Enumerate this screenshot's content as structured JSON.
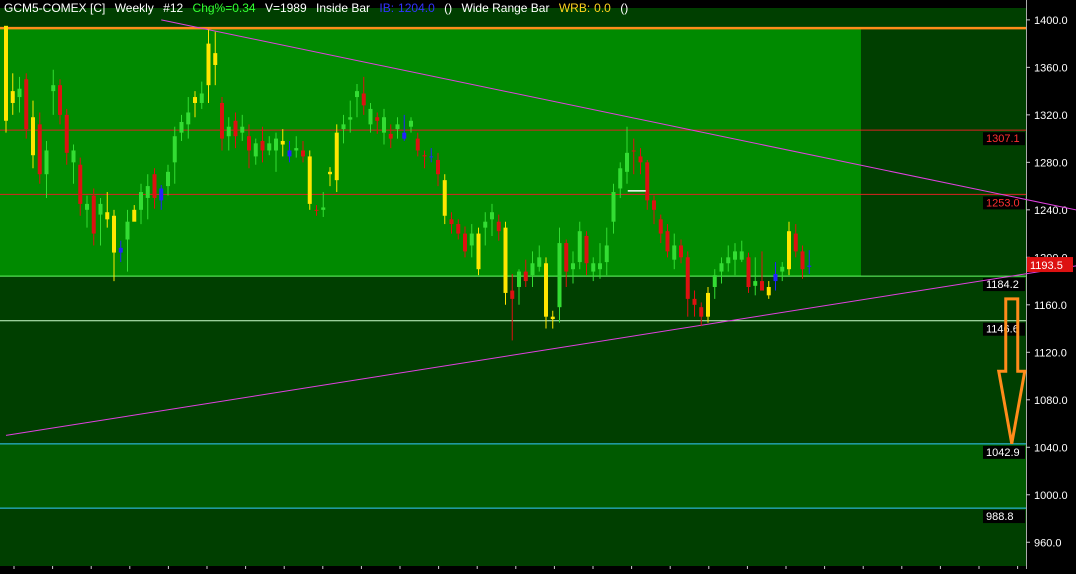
{
  "header": {
    "symbol": "GCM5-COMEX [C]",
    "timeframe": "Weekly",
    "bar_number": "#12",
    "chg_label": "Chg%=",
    "chg_value": "0.34",
    "volume": "V=1989",
    "inside_bar": "Inside Bar",
    "ib_label": "IB:",
    "ib_value": "1204.0",
    "ib_paren": "()",
    "wide_range_bar": "Wide Range Bar",
    "wrb_label": "WRB:",
    "wrb_value": "0.0",
    "wrb_paren": "()"
  },
  "colors": {
    "background": "#000000",
    "panel_bright": "#008a00",
    "panel_dark": "#003f00",
    "panel_mid": "#005a00",
    "up_candle": "#33dd33",
    "down_candle": "#dd1111",
    "inside_bar": "#ffe600",
    "trendline": "#e040e0",
    "resistance": "#dd2222",
    "support": "#66ff66",
    "target": "#33ccff",
    "arrow": "#ff8c1a"
  },
  "chart_data": {
    "type": "candlestick",
    "ylim": [
      940,
      1410
    ],
    "y_ticks": [
      "1400.0",
      "1360.0",
      "1320.0",
      "1280.0",
      "1240.0",
      "1200.0",
      "1160.0",
      "1120.0",
      "1080.0",
      "1040.0",
      "1000.0",
      "960.0"
    ],
    "y_tick_values": [
      1400,
      1360,
      1320,
      1280,
      1240,
      1200,
      1160,
      1120,
      1080,
      1040,
      1000,
      960
    ],
    "last_price": 1193.5,
    "last_price_label": "1193.5",
    "levels": [
      {
        "value": 1393.0,
        "label": "",
        "color": "#ff8c1a"
      },
      {
        "value": 1307.1,
        "label": "1307.1",
        "color": "#dd2222"
      },
      {
        "value": 1253.0,
        "label": "1253.0",
        "color": "#dd2222"
      },
      {
        "value": 1184.2,
        "label": "1184.2",
        "color": "#66ff66"
      },
      {
        "value": 1146.6,
        "label": "1146.6",
        "color": "#ccffcc"
      },
      {
        "value": 1042.9,
        "label": "1042.9",
        "color": "#33ccff"
      },
      {
        "value": 988.8,
        "label": "988.8",
        "color": "#33ccff"
      }
    ],
    "trendlines": [
      {
        "x": [
          23,
          161
        ],
        "y": [
          1400.0,
          1237.0
        ]
      },
      {
        "x": [
          0,
          161
        ],
        "y": [
          1050.0,
          1195.0
        ]
      }
    ],
    "target_arrow": {
      "x": 149,
      "y_from": 1165,
      "y_to": 1043
    },
    "candles": [
      [
        0,
        1395,
        1390,
        1305,
        1315,
        "y"
      ],
      [
        1,
        1340,
        1355,
        1320,
        1330,
        "y"
      ],
      [
        2,
        1342,
        1352,
        1322,
        1335,
        "g"
      ],
      [
        3,
        1350,
        1355,
        1300,
        1308,
        "r"
      ],
      [
        4,
        1318,
        1332,
        1275,
        1286,
        "y"
      ],
      [
        5,
        1312,
        1322,
        1262,
        1270,
        "r"
      ],
      [
        6,
        1290,
        1298,
        1250,
        1270,
        "g"
      ],
      [
        7,
        1340,
        1358,
        1320,
        1345,
        "g"
      ],
      [
        8,
        1345,
        1350,
        1312,
        1320,
        "r"
      ],
      [
        9,
        1320,
        1325,
        1278,
        1288,
        "r"
      ],
      [
        10,
        1290,
        1295,
        1262,
        1280,
        "g"
      ],
      [
        11,
        1278,
        1284,
        1235,
        1245,
        "r"
      ],
      [
        12,
        1240,
        1252,
        1225,
        1245,
        "g"
      ],
      [
        13,
        1252,
        1258,
        1210,
        1220,
        "r"
      ],
      [
        14,
        1245,
        1250,
        1210,
        1236,
        "g"
      ],
      [
        15,
        1238,
        1255,
        1225,
        1232,
        "y"
      ],
      [
        16,
        1235,
        1240,
        1180,
        1204,
        "y"
      ],
      [
        17,
        1208,
        1214,
        1196,
        1204,
        "b"
      ],
      [
        18,
        1215,
        1240,
        1188,
        1230,
        "g"
      ],
      [
        19,
        1230,
        1244,
        1232,
        1240,
        "y"
      ],
      [
        20,
        1240,
        1262,
        1228,
        1255,
        "g"
      ],
      [
        21,
        1250,
        1270,
        1232,
        1260,
        "g"
      ],
      [
        22,
        1270,
        1275,
        1241,
        1250,
        "r"
      ],
      [
        23,
        1248,
        1261,
        1240,
        1258,
        "b"
      ],
      [
        24,
        1260,
        1278,
        1252,
        1272,
        "g"
      ],
      [
        25,
        1280,
        1310,
        1262,
        1302,
        "g"
      ],
      [
        26,
        1305,
        1320,
        1298,
        1314,
        "g"
      ],
      [
        27,
        1312,
        1335,
        1300,
        1322,
        "g"
      ],
      [
        28,
        1330,
        1340,
        1318,
        1335,
        "y"
      ],
      [
        29,
        1338,
        1348,
        1325,
        1330,
        "g"
      ],
      [
        30,
        1345,
        1392,
        1330,
        1380,
        "y"
      ],
      [
        31,
        1372,
        1390,
        1345,
        1362,
        "y"
      ],
      [
        32,
        1330,
        1335,
        1290,
        1300,
        "r"
      ],
      [
        33,
        1302,
        1318,
        1290,
        1310,
        "g"
      ],
      [
        34,
        1315,
        1322,
        1292,
        1302,
        "r"
      ],
      [
        35,
        1305,
        1320,
        1298,
        1310,
        "g"
      ],
      [
        36,
        1302,
        1312,
        1275,
        1290,
        "r"
      ],
      [
        37,
        1285,
        1300,
        1278,
        1296,
        "g"
      ],
      [
        38,
        1298,
        1310,
        1280,
        1290,
        "r"
      ],
      [
        39,
        1290,
        1302,
        1286,
        1296,
        "g"
      ],
      [
        40,
        1290,
        1305,
        1272,
        1300,
        "g"
      ],
      [
        41,
        1298,
        1308,
        1285,
        1295,
        "y"
      ],
      [
        42,
        1290,
        1298,
        1280,
        1285,
        "b"
      ],
      [
        43,
        1292,
        1302,
        1284,
        1290,
        "g"
      ],
      [
        44,
        1290,
        1298,
        1280,
        1285,
        "r"
      ],
      [
        45,
        1285,
        1290,
        1240,
        1245,
        "y"
      ],
      [
        46,
        1240,
        1244,
        1235,
        1240,
        "r"
      ],
      [
        47,
        1240,
        1255,
        1234,
        1242,
        "g"
      ],
      [
        48,
        1270,
        1276,
        1260,
        1272,
        "y"
      ],
      [
        49,
        1265,
        1312,
        1255,
        1305,
        "y"
      ],
      [
        50,
        1308,
        1320,
        1296,
        1312,
        "g"
      ],
      [
        51,
        1316,
        1332,
        1305,
        1318,
        "g"
      ],
      [
        52,
        1335,
        1346,
        1318,
        1340,
        "g"
      ],
      [
        53,
        1338,
        1352,
        1320,
        1328,
        "r"
      ],
      [
        54,
        1325,
        1330,
        1305,
        1312,
        "g"
      ],
      [
        55,
        1315,
        1322,
        1304,
        1318,
        "r"
      ],
      [
        56,
        1318,
        1325,
        1295,
        1305,
        "g"
      ],
      [
        57,
        1304,
        1312,
        1292,
        1300,
        "r"
      ],
      [
        58,
        1308,
        1318,
        1300,
        1312,
        "g"
      ],
      [
        59,
        1305,
        1320,
        1298,
        1300,
        "b"
      ],
      [
        60,
        1310,
        1318,
        1305,
        1315,
        "g"
      ],
      [
        61,
        1300,
        1305,
        1285,
        1290,
        "r"
      ],
      [
        62,
        1286,
        1290,
        1275,
        1285,
        "r"
      ],
      [
        63,
        1285,
        1292,
        1280,
        1285,
        "b"
      ],
      [
        64,
        1282,
        1288,
        1260,
        1270,
        "r"
      ],
      [
        65,
        1265,
        1270,
        1228,
        1235,
        "y"
      ],
      [
        66,
        1232,
        1238,
        1220,
        1228,
        "r"
      ],
      [
        67,
        1228,
        1232,
        1215,
        1220,
        "r"
      ],
      [
        68,
        1220,
        1226,
        1200,
        1205,
        "r"
      ],
      [
        69,
        1210,
        1228,
        1200,
        1220,
        "g"
      ],
      [
        70,
        1220,
        1225,
        1185,
        1190,
        "y"
      ],
      [
        71,
        1225,
        1238,
        1210,
        1230,
        "g"
      ],
      [
        72,
        1232,
        1245,
        1218,
        1238,
        "g"
      ],
      [
        73,
        1230,
        1236,
        1214,
        1222,
        "r"
      ],
      [
        74,
        1225,
        1230,
        1160,
        1170,
        "y"
      ],
      [
        75,
        1172,
        1186,
        1130,
        1165,
        "r"
      ],
      [
        76,
        1175,
        1190,
        1160,
        1188,
        "g"
      ],
      [
        77,
        1188,
        1198,
        1175,
        1180,
        "r"
      ],
      [
        78,
        1185,
        1205,
        1175,
        1195,
        "g"
      ],
      [
        79,
        1200,
        1210,
        1188,
        1192,
        "g"
      ],
      [
        80,
        1195,
        1200,
        1140,
        1150,
        "y"
      ],
      [
        81,
        1148,
        1155,
        1140,
        1150,
        "y"
      ],
      [
        82,
        1158,
        1225,
        1145,
        1212,
        "g"
      ],
      [
        83,
        1212,
        1215,
        1175,
        1188,
        "r"
      ],
      [
        84,
        1190,
        1205,
        1178,
        1195,
        "g"
      ],
      [
        85,
        1196,
        1230,
        1190,
        1222,
        "g"
      ],
      [
        86,
        1218,
        1222,
        1185,
        1195,
        "r"
      ],
      [
        87,
        1195,
        1200,
        1180,
        1188,
        "g"
      ],
      [
        88,
        1190,
        1212,
        1182,
        1195,
        "g"
      ],
      [
        89,
        1196,
        1225,
        1185,
        1210,
        "g"
      ],
      [
        90,
        1230,
        1262,
        1220,
        1255,
        "g"
      ],
      [
        91,
        1258,
        1280,
        1250,
        1275,
        "g"
      ],
      [
        92,
        1272,
        1310,
        1262,
        1288,
        "g"
      ],
      [
        93,
        1290,
        1300,
        1270,
        1290,
        "r"
      ],
      [
        94,
        1285,
        1292,
        1270,
        1280,
        "r"
      ],
      [
        95,
        1280,
        1282,
        1240,
        1248,
        "r"
      ],
      [
        96,
        1248,
        1252,
        1228,
        1240,
        "r"
      ],
      [
        97,
        1232,
        1236,
        1212,
        1220,
        "r"
      ],
      [
        98,
        1222,
        1228,
        1200,
        1205,
        "r"
      ],
      [
        99,
        1198,
        1220,
        1190,
        1210,
        "g"
      ],
      [
        100,
        1210,
        1215,
        1195,
        1200,
        "r"
      ],
      [
        101,
        1200,
        1205,
        1150,
        1165,
        "r"
      ],
      [
        102,
        1165,
        1172,
        1150,
        1160,
        "r"
      ],
      [
        103,
        1158,
        1162,
        1142,
        1150,
        "r"
      ],
      [
        104,
        1150,
        1175,
        1145,
        1170,
        "y"
      ],
      [
        105,
        1175,
        1190,
        1165,
        1185,
        "g"
      ],
      [
        106,
        1188,
        1200,
        1178,
        1195,
        "g"
      ],
      [
        107,
        1195,
        1210,
        1188,
        1200,
        "g"
      ],
      [
        108,
        1198,
        1212,
        1185,
        1205,
        "g"
      ],
      [
        109,
        1205,
        1214,
        1196,
        1198,
        "g"
      ],
      [
        110,
        1200,
        1204,
        1170,
        1175,
        "r"
      ],
      [
        111,
        1176,
        1200,
        1168,
        1180,
        "g"
      ],
      [
        112,
        1180,
        1205,
        1175,
        1172,
        "r"
      ],
      [
        113,
        1175,
        1180,
        1165,
        1168,
        "y"
      ],
      [
        114,
        1180,
        1196,
        1172,
        1186,
        "b"
      ],
      [
        115,
        1188,
        1196,
        1180,
        1192,
        "g"
      ],
      [
        116,
        1190,
        1230,
        1185,
        1222,
        "y"
      ],
      [
        117,
        1220,
        1228,
        1200,
        1205,
        "r"
      ],
      [
        118,
        1205,
        1210,
        1182,
        1190,
        "r"
      ],
      [
        119,
        1192,
        1206,
        1186,
        1193,
        "b"
      ]
    ]
  }
}
